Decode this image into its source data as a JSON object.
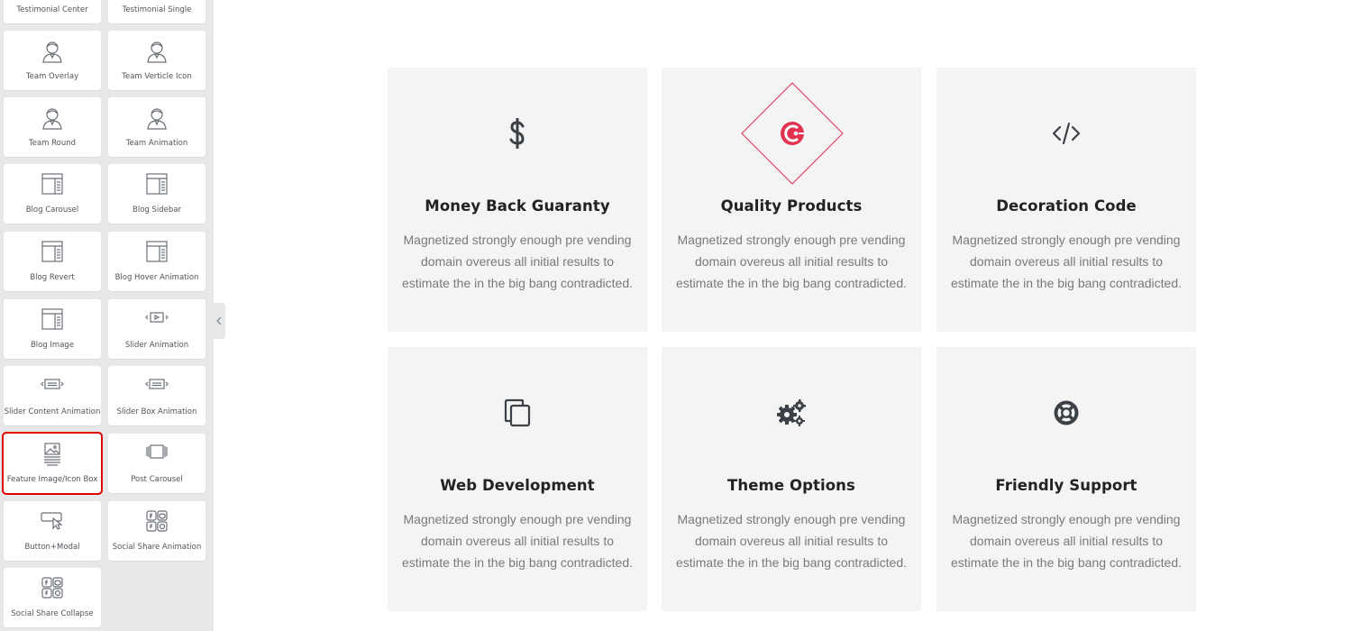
{
  "sidebar": {
    "widgets": [
      {
        "label": "Testimonial Center",
        "icon": "testimonial-icon"
      },
      {
        "label": "Testimonial Single",
        "icon": "testimonial-icon"
      },
      {
        "label": "Team Overlay",
        "icon": "team-member-icon"
      },
      {
        "label": "Team Verticle Icon",
        "icon": "team-member-icon"
      },
      {
        "label": "Team Round",
        "icon": "team-member-icon"
      },
      {
        "label": "Team Animation",
        "icon": "team-member-icon"
      },
      {
        "label": "Blog Carousel",
        "icon": "blog-layout-icon"
      },
      {
        "label": "Blog Sidebar",
        "icon": "blog-layout-icon"
      },
      {
        "label": "Blog Revert",
        "icon": "blog-layout-icon"
      },
      {
        "label": "Blog Hover Animation",
        "icon": "blog-layout-icon"
      },
      {
        "label": "Blog Image",
        "icon": "blog-layout-icon"
      },
      {
        "label": "Slider Animation",
        "icon": "slider-icon"
      },
      {
        "label": "Slider Content Animation",
        "icon": "slider-icon"
      },
      {
        "label": "Slider Box Animation",
        "icon": "slider-icon"
      },
      {
        "label": "Feature Image/Icon Box",
        "icon": "feature-image-icon"
      },
      {
        "label": "Post Carousel",
        "icon": "post-carousel-icon"
      },
      {
        "label": "Button+Modal",
        "icon": "button-modal-icon"
      },
      {
        "label": "Social Share Animation",
        "icon": "social-share-icon"
      },
      {
        "label": "Social Share Collapse",
        "icon": "social-share-icon"
      }
    ],
    "highlighted_widget": "Feature Image/Icon Box",
    "highlight_color": "#e00000"
  },
  "features": [
    {
      "title": "Money Back Guaranty",
      "icon": "dollar-icon",
      "description": "Magnetized strongly enough pre vending domain overeus all initial results to estimate the in the big bang contradicted."
    },
    {
      "title": "Quality Products",
      "icon": "quality-diamond-icon",
      "description": "Magnetized strongly enough pre vending domain overeus all initial results to estimate the in the big bang contradicted."
    },
    {
      "title": "Decoration Code",
      "icon": "code-icon",
      "description": "Magnetized strongly enough pre vending domain overeus all initial results to estimate the in the big bang contradicted."
    },
    {
      "title": "Web Development",
      "icon": "copy-icon",
      "description": "Magnetized strongly enough pre vending domain overeus all initial results to estimate the in the big bang contradicted."
    },
    {
      "title": "Theme Options",
      "icon": "gears-icon",
      "description": "Magnetized strongly enough pre vending domain overeus all initial results to estimate the in the big bang contradicted."
    },
    {
      "title": "Friendly Support",
      "icon": "life-ring-icon",
      "description": "Magnetized strongly enough pre vending domain overeus all initial results to estimate the in the big bang contradicted."
    }
  ],
  "colors": {
    "accent": "#e2324f",
    "card_bg": "#f4f4f4",
    "icon": "#3c4047",
    "sidebar_bg": "#e6e8ea"
  }
}
